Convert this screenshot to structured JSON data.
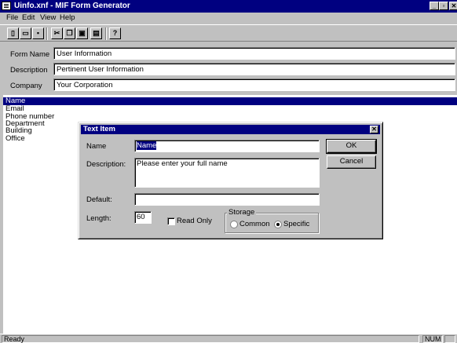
{
  "window": {
    "title": "Uinfo.xnf - MIF Form Generator",
    "min_glyph": "_",
    "max_glyph": "▫",
    "close_glyph": "✕"
  },
  "menu": {
    "items": [
      {
        "label": "File"
      },
      {
        "label": "Edit"
      },
      {
        "label": "View"
      },
      {
        "label": "Help"
      }
    ]
  },
  "toolbar": {
    "buttons": [
      {
        "name": "new",
        "glyph": "▯"
      },
      {
        "name": "open",
        "glyph": "▭"
      },
      {
        "name": "save",
        "glyph": "▪"
      },
      {
        "name": "cut",
        "glyph": "✂"
      },
      {
        "name": "copy",
        "glyph": "❐"
      },
      {
        "name": "paste",
        "glyph": "▣"
      },
      {
        "name": "print",
        "glyph": "▤"
      },
      {
        "name": "help",
        "glyph": "?"
      }
    ]
  },
  "form": {
    "name_label": "Form Name",
    "name_value": "User Information",
    "description_label": "Description",
    "description_value": "Pertinent User Information",
    "company_label": "Company",
    "company_value": "Your Corporation"
  },
  "list": {
    "items": [
      "Name",
      "Email",
      "Phone number",
      "Department",
      "Building",
      "Office"
    ],
    "selected_index": 0
  },
  "dialog": {
    "title": "Text Item",
    "name_label": "Name",
    "name_value": "Name",
    "description_label": "Description:",
    "description_value": "Please enter your full name",
    "default_label": "Default:",
    "default_value": "",
    "length_label": "Length:",
    "length_value": "60",
    "readonly_label": "Read Only",
    "readonly_checked": false,
    "storage_label": "Storage",
    "storage_common_label": "Common",
    "storage_specific_label": "Specific",
    "storage_selected": "Specific",
    "ok_label": "OK",
    "cancel_label": "Cancel",
    "close_glyph": "✕"
  },
  "status": {
    "text": "Ready",
    "num": "NUM"
  }
}
